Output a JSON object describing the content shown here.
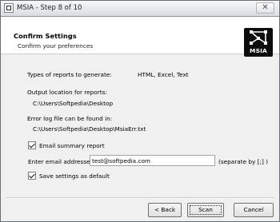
{
  "window": {
    "title": "MSIA - Step 8 of 10",
    "close_glyph": "✕"
  },
  "header": {
    "title": "Confirm Settings",
    "subtitle": "Confirm your preferences",
    "logo_text": "MSIA"
  },
  "settings": {
    "reports_label": "Types of reports to generate:",
    "reports_value": "HTML, Excel, Text",
    "output_label": "Output location for reports:",
    "output_value": "C:\\Users\\Softpedia\\Desktop",
    "errorlog_label": "Error log file can be found in:",
    "errorlog_value": "C:\\Users\\Softpedia\\Desktop\\MsiaErr.txt",
    "email_summary_label": "Email summary report",
    "email_summary_checked": true,
    "email_label": "Enter email addresses:",
    "email_value": "test@softpedia.com",
    "email_hint": "(separate by [;] )",
    "save_label": "Save settings as default",
    "save_checked": true
  },
  "buttons": {
    "back": "< Back",
    "scan": "Scan",
    "cancel": "Cancel"
  }
}
